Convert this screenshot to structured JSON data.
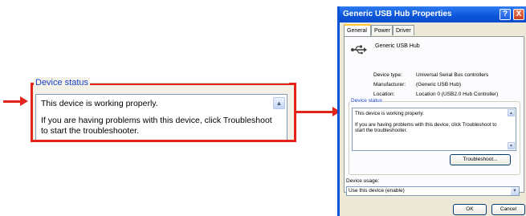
{
  "dialog": {
    "title": "Generic USB Hub Properties",
    "help_label": "?",
    "close_label": "X",
    "tabs": [
      "General",
      "Power",
      "Driver"
    ],
    "device_name": "Generic USB Hub",
    "icon": "usb-icon",
    "properties": [
      {
        "label": "Device type:",
        "value": "Universal Serial Bus controllers"
      },
      {
        "label": "Manufacturer:",
        "value": "(Generic USB Hub)"
      },
      {
        "label": "Location:",
        "value": "Location 0 (USB2.0 Hub Controller)"
      }
    ],
    "status_legend": "Device status",
    "status_line1": "This device is working properly.",
    "status_line2": "If you are having problems with this device, click Troubleshoot to start the troubleshooter.",
    "troubleshoot_label": "Troubleshoot...",
    "usage_label": "Device usage:",
    "usage_value": "Use this device (enable)",
    "ok_label": "OK",
    "cancel_label": "Cancel"
  },
  "zoom": {
    "legend": "Device status",
    "line1": "This device is working properly.",
    "line2": "If you are having problems with this device, click Troubleshoot to start the troubleshooter."
  },
  "colors": {
    "callout": "#e2241b",
    "title_bar": "#0a55d8",
    "legend_text": "#1b42c8"
  }
}
